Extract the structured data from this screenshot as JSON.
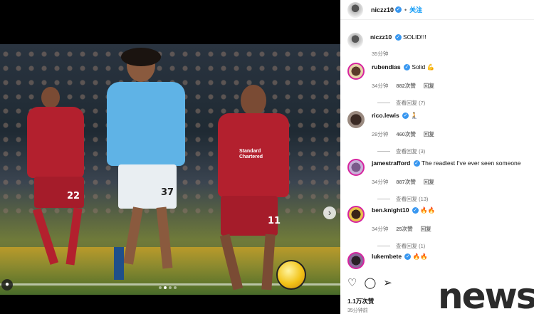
{
  "post": {
    "owner": "niczz10",
    "follow_label": "关注",
    "caption": "SOLID!!!",
    "caption_time": "35分钟",
    "likes": "1.1万次赞",
    "posted": "35分钟前",
    "carousel_slide": "2 of 4"
  },
  "photo": {
    "jersey_numbers": [
      "22",
      "37",
      "11"
    ],
    "sponsor": "Standard Chartered"
  },
  "comments": [
    {
      "user": "rubendias",
      "text": "Solid",
      "emoji": "💪",
      "time": "34分钟",
      "likes": "882次赞",
      "reply": "回复",
      "view_replies": "查看回复 (7)"
    },
    {
      "user": "rico.lewis",
      "text": "",
      "emoji": "🧎",
      "time": "28分钟",
      "likes": "460次赞",
      "reply": "回复",
      "view_replies": "查看回复 (3)"
    },
    {
      "user": "jamestrafford",
      "text": "The readiest I've ever seen someone",
      "emoji": "",
      "time": "34分钟",
      "likes": "887次赞",
      "reply": "回复",
      "view_replies": "查看回复 (13)"
    },
    {
      "user": "ben.knight10",
      "text": "",
      "emoji": "🔥🔥",
      "time": "34分钟",
      "likes": "25次赞",
      "reply": "回复",
      "view_replies": "查看回复 (1)"
    },
    {
      "user": "lukembete",
      "text": "",
      "emoji": "🔥🔥",
      "time": "",
      "likes": "",
      "reply": "",
      "view_replies": ""
    }
  ],
  "watermark": "news",
  "colors": {
    "link": "#0095f6",
    "verified": "#3897f0",
    "city_blue": "#5fb3e6",
    "liverpool_red": "#b3202e"
  }
}
